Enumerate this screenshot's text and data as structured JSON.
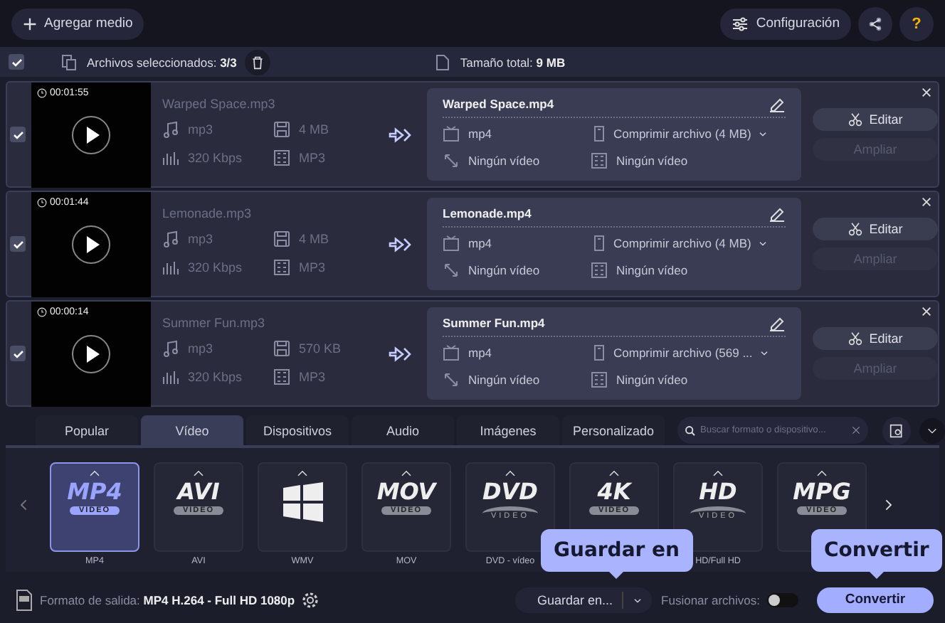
{
  "toolbar": {
    "add_button": "Agregar medio",
    "settings_button": "Configuración",
    "help_button": "?"
  },
  "selection_bar": {
    "checked": true,
    "selected_label": "Archivos seleccionados:",
    "selected_count": "3/3",
    "total_label": "Tamaño total:",
    "total_value": "9 MB"
  },
  "files": [
    {
      "checked": true,
      "duration": "00:01:55",
      "source_name": "Warped Space.mp3",
      "format": "mp3",
      "size": "4 MB",
      "bitrate": "320 Kbps",
      "codec": "MP3",
      "output_name": "Warped Space.mp4",
      "output_format": "mp4",
      "compression": "Comprimir archivo (4 MB)",
      "video": "Ningún vídeo",
      "subtitles": "Ningún vídeo",
      "edit_button": "Editar",
      "enhance_button": "Ampliar",
      "enhance_disabled": true
    },
    {
      "checked": true,
      "duration": "00:01:44",
      "source_name": "Lemonade.mp3",
      "format": "mp3",
      "size": "4 MB",
      "bitrate": "320 Kbps",
      "codec": "MP3",
      "output_name": "Lemonade.mp4",
      "output_format": "mp4",
      "compression": "Comprimir archivo (4 MB)",
      "video": "Ningún vídeo",
      "subtitles": "Ningún vídeo",
      "edit_button": "Editar",
      "enhance_button": "Ampliar",
      "enhance_disabled": true
    },
    {
      "checked": true,
      "duration": "00:00:14",
      "source_name": "Summer Fun.mp3",
      "format": "mp3",
      "size": "570 KB",
      "bitrate": "320 Kbps",
      "codec": "MP3",
      "output_name": "Summer Fun.mp4",
      "output_format": "mp4",
      "compression": "Comprimir archivo (569 ...",
      "video": "Ningún vídeo",
      "subtitles": "Ningún vídeo",
      "edit_button": "Editar",
      "enhance_button": "Ampliar",
      "enhance_disabled": true
    }
  ],
  "format_tabs": [
    {
      "label": "Popular",
      "selected": false
    },
    {
      "label": "Vídeo",
      "selected": true
    },
    {
      "label": "Dispositivos",
      "selected": false
    },
    {
      "label": "Audio",
      "selected": false
    },
    {
      "label": "Imágenes",
      "selected": false
    },
    {
      "label": "Personalizado",
      "selected": false
    }
  ],
  "search": {
    "placeholder": "Buscar formato o dispositivo..."
  },
  "formats": [
    {
      "kind": "badge",
      "logo": "MP4",
      "sub": "VIDEO",
      "label": "MP4",
      "selected": true
    },
    {
      "kind": "badge",
      "logo": "AVI",
      "sub": "VIDEO",
      "label": "AVI",
      "selected": false
    },
    {
      "kind": "windows",
      "label": "WMV",
      "selected": false
    },
    {
      "kind": "badge",
      "logo": "MOV",
      "sub": "VIDEO",
      "label": "MOV",
      "selected": false
    },
    {
      "kind": "disc",
      "logo": "DVD",
      "sub": "VIDEO",
      "label": "DVD - vídeo",
      "selected": false
    },
    {
      "kind": "badge",
      "logo": "4K",
      "sub": "VIDEO",
      "selected": false
    },
    {
      "kind": "disc",
      "logo": "HD",
      "sub": "VIDEO",
      "label": "HD/Full HD",
      "selected": false
    },
    {
      "kind": "badge",
      "logo": "MPG",
      "sub": "VIDEO",
      "selected": false
    }
  ],
  "tooltips": [
    {
      "text": "Guardar en"
    },
    {
      "text": "Convertir"
    }
  ],
  "bottom": {
    "output_label": "Formato de salida:",
    "output_value": "MP4 H.264 - Full HD 1080p",
    "save_button": "Guardar en...",
    "merge_label": "Fusionar archivos:",
    "merge_on": false,
    "convert_button": "Convertir"
  }
}
